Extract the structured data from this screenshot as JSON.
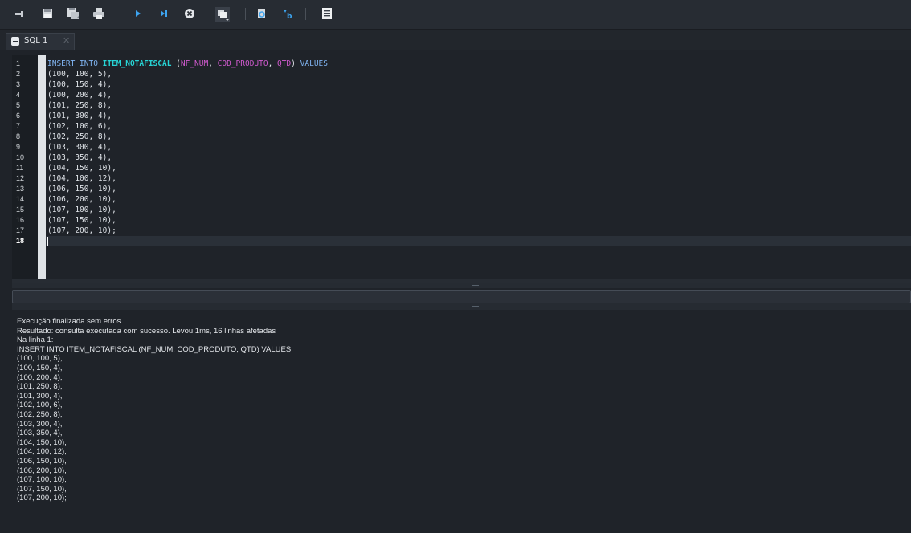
{
  "toolbar": {
    "buttons": [
      {
        "icon": "new-connection-icon"
      },
      {
        "icon": "save-icon"
      },
      {
        "icon": "save-as-icon"
      },
      {
        "icon": "print-icon"
      },
      {
        "icon": "execute-icon"
      },
      {
        "icon": "execute-step-icon"
      },
      {
        "icon": "stop-icon"
      },
      {
        "icon": "commit-icon"
      },
      {
        "icon": "find-icon"
      },
      {
        "icon": "replace-icon"
      },
      {
        "icon": "format-icon"
      }
    ]
  },
  "tabs": [
    {
      "label": "SQL 1",
      "close": "✕",
      "active": true
    }
  ],
  "editor": {
    "current_line": 18,
    "lines": [
      {
        "num": "1",
        "tokens": [
          {
            "t": "INSERT INTO ",
            "c": "kw"
          },
          {
            "t": "ITEM_NOTAFISCAL",
            "c": "tbl"
          },
          {
            "t": " (",
            "c": "pn"
          },
          {
            "t": "NF_NUM",
            "c": "col"
          },
          {
            "t": ", ",
            "c": "pn"
          },
          {
            "t": "COD_PRODUTO",
            "c": "col"
          },
          {
            "t": ", ",
            "c": "pn"
          },
          {
            "t": "QTD",
            "c": "col"
          },
          {
            "t": ") ",
            "c": "pn"
          },
          {
            "t": "VALUES",
            "c": "kw"
          }
        ]
      },
      {
        "num": "2",
        "tokens": [
          {
            "t": "(100, 100, 5),",
            "c": "pn"
          }
        ]
      },
      {
        "num": "3",
        "tokens": [
          {
            "t": "(100, 150, 4),",
            "c": "pn"
          }
        ]
      },
      {
        "num": "4",
        "tokens": [
          {
            "t": "(100, 200, 4),",
            "c": "pn"
          }
        ]
      },
      {
        "num": "5",
        "tokens": [
          {
            "t": "(101, 250, 8),",
            "c": "pn"
          }
        ]
      },
      {
        "num": "6",
        "tokens": [
          {
            "t": "(101, 300, 4),",
            "c": "pn"
          }
        ]
      },
      {
        "num": "7",
        "tokens": [
          {
            "t": "(102, 100, 6),",
            "c": "pn"
          }
        ]
      },
      {
        "num": "8",
        "tokens": [
          {
            "t": "(102, 250, 8),",
            "c": "pn"
          }
        ]
      },
      {
        "num": "9",
        "tokens": [
          {
            "t": "(103, 300, 4),",
            "c": "pn"
          }
        ]
      },
      {
        "num": "10",
        "tokens": [
          {
            "t": "(103, 350, 4),",
            "c": "pn"
          }
        ]
      },
      {
        "num": "11",
        "tokens": [
          {
            "t": "(104, 150, 10),",
            "c": "pn"
          }
        ]
      },
      {
        "num": "12",
        "tokens": [
          {
            "t": "(104, 100, 12),",
            "c": "pn"
          }
        ]
      },
      {
        "num": "13",
        "tokens": [
          {
            "t": "(106, 150, 10),",
            "c": "pn"
          }
        ]
      },
      {
        "num": "14",
        "tokens": [
          {
            "t": "(106, 200, 10),",
            "c": "pn"
          }
        ]
      },
      {
        "num": "15",
        "tokens": [
          {
            "t": "(107, 100, 10),",
            "c": "pn"
          }
        ]
      },
      {
        "num": "16",
        "tokens": [
          {
            "t": "(107, 150, 10),",
            "c": "pn"
          }
        ]
      },
      {
        "num": "17",
        "tokens": [
          {
            "t": "(107, 200, 10);",
            "c": "pn"
          }
        ]
      },
      {
        "num": "18",
        "tokens": []
      }
    ]
  },
  "output": {
    "lines": [
      "Execução finalizada sem erros.",
      "Resultado: consulta executada com sucesso. Levou 1ms, 16 linhas afetadas",
      "Na linha 1:",
      "INSERT INTO ITEM_NOTAFISCAL (NF_NUM, COD_PRODUTO, QTD) VALUES",
      "(100, 100, 5),",
      "(100, 150, 4),",
      "(100, 200, 4),",
      "(101, 250, 8),",
      "(101, 300, 4),",
      "(102, 100, 6),",
      "(102, 250, 8),",
      "(103, 300, 4),",
      "(103, 350, 4),",
      "(104, 150, 10),",
      "(104, 100, 12),",
      "(106, 150, 10),",
      "(106, 200, 10),",
      "(107, 100, 10),",
      "(107, 150, 10),",
      "(107, 200, 10);"
    ]
  },
  "colors": {
    "keyword": "#7fb3f0",
    "table": "#27d5d6",
    "column": "#d25bd0",
    "text": "#dfe3e8",
    "background": "#1f2329"
  }
}
